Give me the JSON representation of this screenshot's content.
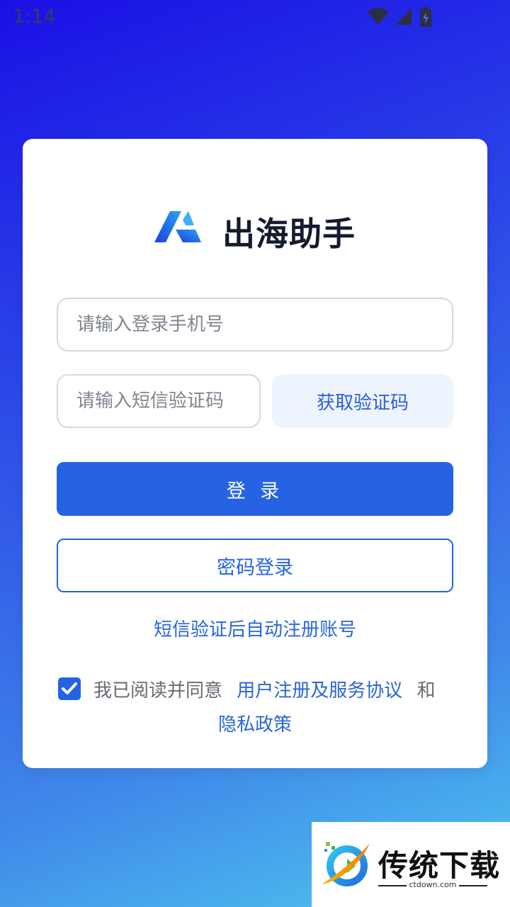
{
  "status_bar": {
    "time": "1:14"
  },
  "app": {
    "name": "出海助手"
  },
  "form": {
    "phone_placeholder": "请输入登录手机号",
    "code_placeholder": "请输入短信验证码",
    "get_code_label": "获取验证码",
    "login_label": "登 录",
    "password_login_label": "密码登录",
    "auto_register_text": "短信验证后自动注册账号"
  },
  "agreement": {
    "checked": true,
    "prefix": "我已阅读并同意",
    "terms_link": "用户注册及服务协议",
    "conjunction": "和",
    "privacy_link": "隐私政策"
  },
  "watermark": {
    "title": "传统下载",
    "domain": "ctdown.com"
  },
  "colors": {
    "accent": "#2563e3",
    "link": "#2a66d8",
    "get_code_bg": "#eef4fd"
  }
}
